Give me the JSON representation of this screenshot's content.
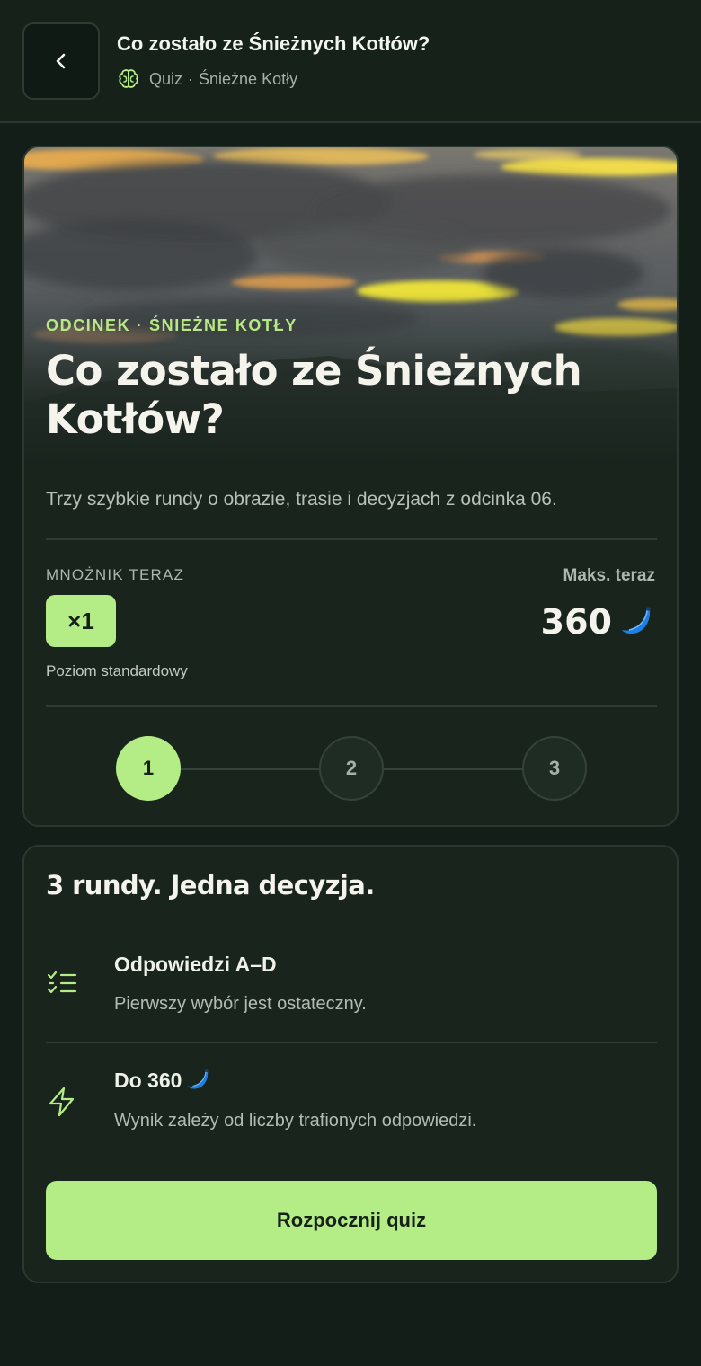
{
  "header": {
    "title": "Co zostało ze Śnieżnych Kotłów?",
    "type_label": "Quiz",
    "separator": "·",
    "series_label": "Śnieżne Kotły"
  },
  "hero": {
    "kicker": "ODCINEK · ŚNIEŻNE KOTŁY",
    "title": "Co zostało ze Śnieżnych Kotłów?",
    "description": "Trzy szybkie rundy o obrazie, trasie i decyzjach z odcinka 06."
  },
  "multiplier": {
    "label": "MNOŻNIK TERAZ",
    "value": "×1",
    "level": "Poziom standardowy"
  },
  "max_score": {
    "label": "Maks. teraz",
    "value": "360",
    "currency_icon": "banana-icon"
  },
  "steps": [
    {
      "label": "1",
      "state": "active"
    },
    {
      "label": "2",
      "state": "idle"
    },
    {
      "label": "3",
      "state": "idle"
    }
  ],
  "rules": {
    "title": "3 rundy. Jedna decyzja.",
    "items": [
      {
        "icon": "checklist-icon",
        "title": "Odpowiedzi A–D",
        "description": "Pierwszy wybór jest ostateczny."
      },
      {
        "icon": "lightning-icon",
        "title": "Do 360",
        "description": "Wynik zależy od liczby trafionych odpowiedzi."
      }
    ],
    "start_label": "Rozpocznij quiz"
  },
  "colors": {
    "background": "#131e18",
    "card": "#18241c",
    "accent": "#b4ec86",
    "banana": "#1f7fe0"
  }
}
